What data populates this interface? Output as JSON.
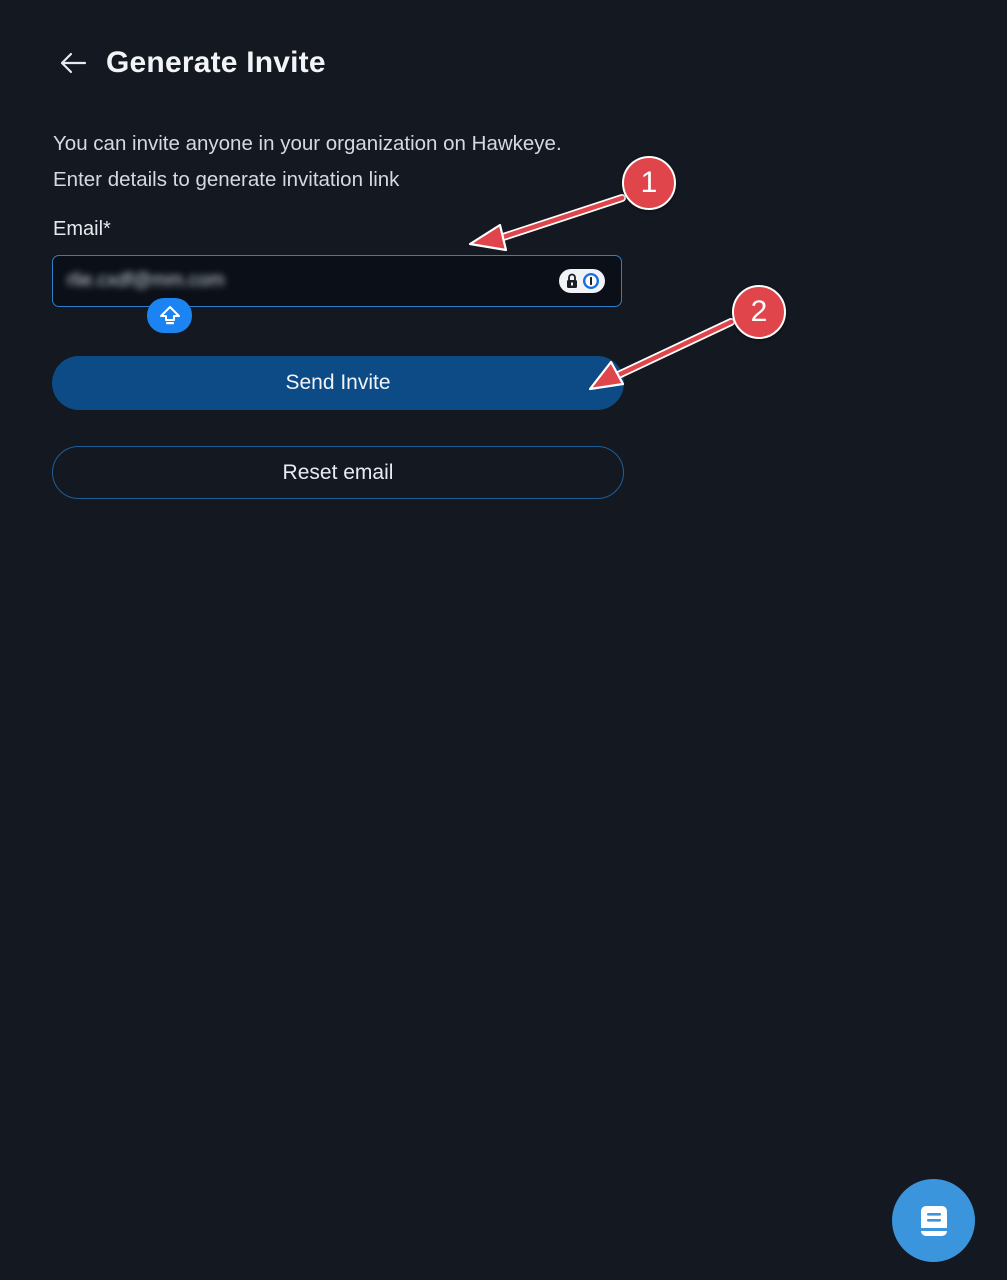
{
  "header": {
    "title": "Generate Invite",
    "back_icon": "arrow-left-icon"
  },
  "description": {
    "line1": "You can invite anyone in your organization on Hawkeye.",
    "line2": "Enter details to generate invitation link"
  },
  "form": {
    "email_label": "Email*",
    "email_value": "rlie.cxdf@mm.com",
    "password_manager_icon": "password-manager-icon",
    "autofill_icon": "autofill-upload-icon"
  },
  "buttons": {
    "send_label": "Send Invite",
    "reset_label": "Reset email"
  },
  "annotations": {
    "step1": "1",
    "step2": "2"
  },
  "help_widget": {
    "icon": "book-icon"
  },
  "colors": {
    "background": "#131821",
    "primary_button": "#0c4b85",
    "input_border": "#2f7ec9",
    "annotation": "#e0454b",
    "help_button": "#3a95dd"
  }
}
